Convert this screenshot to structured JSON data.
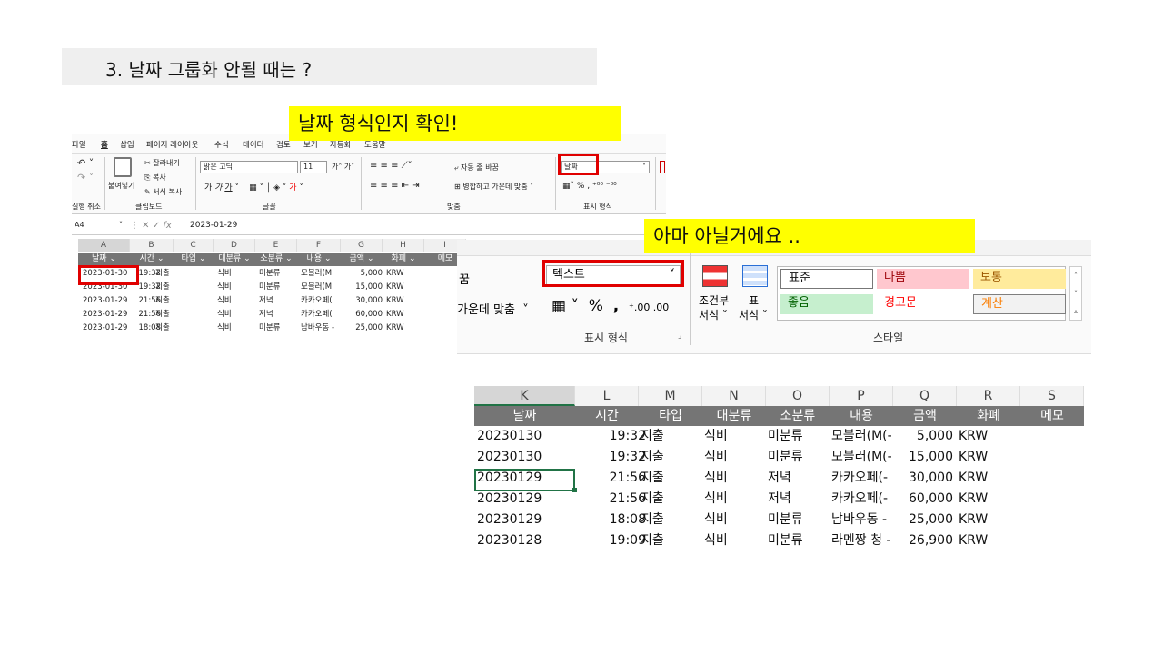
{
  "slide": {
    "title": "3. 날짜 그룹화 안될 때는 ?",
    "callout1": "날짜 형식인지 확인!",
    "callout2": "아마 아닐거에요 .."
  },
  "left_excel": {
    "menu": [
      "파일",
      "홈",
      "삽입",
      "페이지 레이아웃",
      "수식",
      "데이터",
      "검토",
      "보기",
      "자동화",
      "도움말"
    ],
    "ribbon": {
      "undo_label": "실행 취소",
      "clipboard_label": "클립보드",
      "paste_label": "붙여넣기",
      "cut_label": "잘라내기",
      "copy_label": "복사",
      "format_painter_label": "서식 복사",
      "font_name": "맑은 고딕",
      "font_size": "11",
      "font_label": "글꼴",
      "wrap_label": "자동 줄 바꿈",
      "merge_label": "병합하고 가운데 맞춤",
      "align_label": "맞춤",
      "number_format": "날짜",
      "number_label": "표시 형식",
      "cond_label": "조건부 서식"
    },
    "name_box": "A4",
    "formula": "2023-01-29",
    "col_headers": [
      "A",
      "B",
      "C",
      "D",
      "E",
      "F",
      "G",
      "H",
      "I"
    ],
    "headers": [
      "날짜",
      "시간",
      "타입",
      "대분류",
      "소분류",
      "내용",
      "금액",
      "화폐",
      "메모"
    ],
    "rows": [
      [
        "2023-01-30",
        "19:32",
        "지출",
        "식비",
        "미분류",
        "모블러(M",
        "5,000",
        "KRW"
      ],
      [
        "2023-01-30",
        "19:32",
        "지출",
        "식비",
        "미분류",
        "모블러(M",
        "15,000",
        "KRW"
      ],
      [
        "2023-01-29",
        "21:56",
        "지출",
        "식비",
        "저녁",
        "카카오페(",
        "30,000",
        "KRW"
      ],
      [
        "2023-01-29",
        "21:56",
        "지출",
        "식비",
        "저녁",
        "카카오페(",
        "60,000",
        "KRW"
      ],
      [
        "2023-01-29",
        "18:08",
        "지출",
        "식비",
        "미분류",
        "남바우동 -",
        "25,000",
        "KRW"
      ]
    ]
  },
  "ribbon_zoom": {
    "left_cut_text1": "꿈",
    "left_cut_text2": "가운데 맞춤",
    "number_format": "텍스트",
    "number_label": "표시 형식",
    "cond_format_label1": "조건부",
    "cond_format_label2": "서식",
    "table_format_label1": "표",
    "table_format_label2": "서식",
    "styles_label": "스타일",
    "styles": [
      {
        "label": "표준",
        "bg": "#ffffff",
        "color": "#111111"
      },
      {
        "label": "나쁨",
        "bg": "#ffc7ce",
        "color": "#9c0006"
      },
      {
        "label": "보통",
        "bg": "#ffeb9c",
        "color": "#9c5700"
      },
      {
        "label": "좋음",
        "bg": "#c6efce",
        "color": "#006100"
      },
      {
        "label": "경고문",
        "bg": "#ffffff",
        "color": "#ff0000"
      },
      {
        "label": "계산",
        "bg": "#f2f2f2",
        "color": "#fa7d00"
      }
    ]
  },
  "right_sheet": {
    "col_headers": [
      "K",
      "L",
      "M",
      "N",
      "O",
      "P",
      "Q",
      "R",
      "S"
    ],
    "headers": [
      "날짜",
      "시간",
      "타입",
      "대분류",
      "소분류",
      "내용",
      "금액",
      "화폐",
      "메모"
    ],
    "rows": [
      [
        "20230130",
        "19:32",
        "지출",
        "식비",
        "미분류",
        "모블러(M(-",
        "5,000",
        "KRW"
      ],
      [
        "20230130",
        "19:32",
        "지출",
        "식비",
        "미분류",
        "모블러(M(-",
        "15,000",
        "KRW"
      ],
      [
        "20230129",
        "21:56",
        "지출",
        "식비",
        "저녁",
        "카카오페(-",
        "30,000",
        "KRW"
      ],
      [
        "20230129",
        "21:56",
        "지출",
        "식비",
        "저녁",
        "카카오페(-",
        "60,000",
        "KRW"
      ],
      [
        "20230129",
        "18:08",
        "지출",
        "식비",
        "미분류",
        "남바우동 -",
        "25,000",
        "KRW"
      ],
      [
        "20230128",
        "19:09",
        "지출",
        "식비",
        "미분류",
        "라멘짱 청 -",
        "26,900",
        "KRW"
      ]
    ]
  }
}
